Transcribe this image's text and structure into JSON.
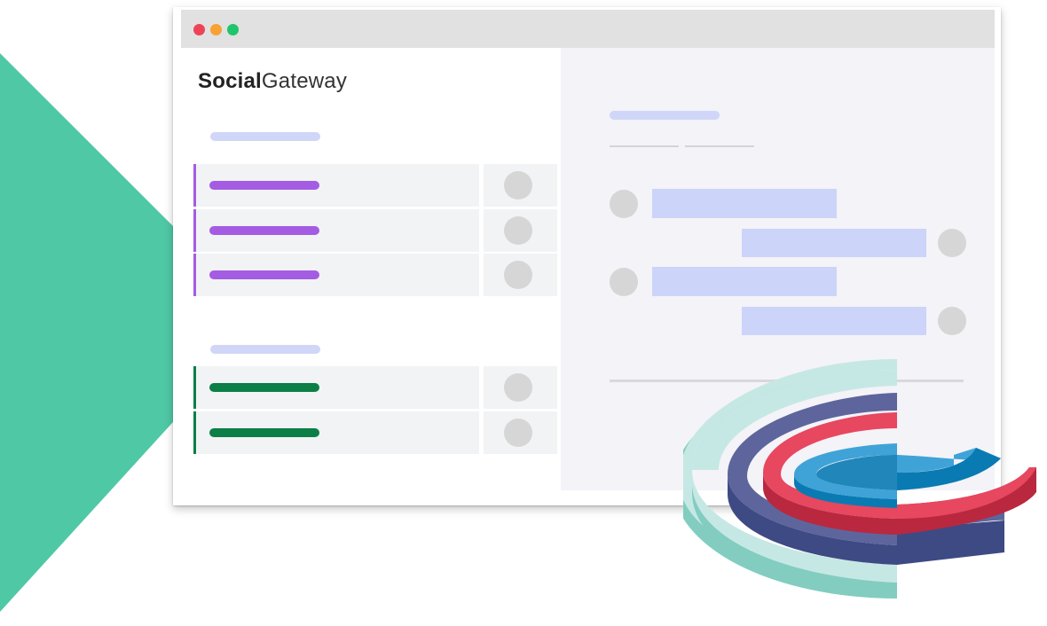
{
  "brand": {
    "name_bold": "Social",
    "name_light": "Gateway"
  },
  "window": {
    "controls": [
      "close",
      "minimize",
      "maximize"
    ]
  },
  "sidebar": {
    "groups": [
      {
        "accent": "#a45ce3",
        "items": 3
      },
      {
        "accent": "#0b7f46",
        "items": 2
      }
    ]
  },
  "chat": {
    "messages": [
      {
        "side": "left"
      },
      {
        "side": "right"
      },
      {
        "side": "left"
      },
      {
        "side": "right"
      }
    ]
  },
  "colors": {
    "triangle": "#4fc8a6",
    "placeholder": "#cdd4f9",
    "purple": "#a45ce3",
    "green": "#0b7f46",
    "ring_teal": "#c6e8e4",
    "ring_navy": "#5e659c",
    "ring_red": "#e7475f",
    "ring_blue": "#3fa3d8"
  },
  "decoration": {
    "icon": "donut-rings-3d"
  }
}
